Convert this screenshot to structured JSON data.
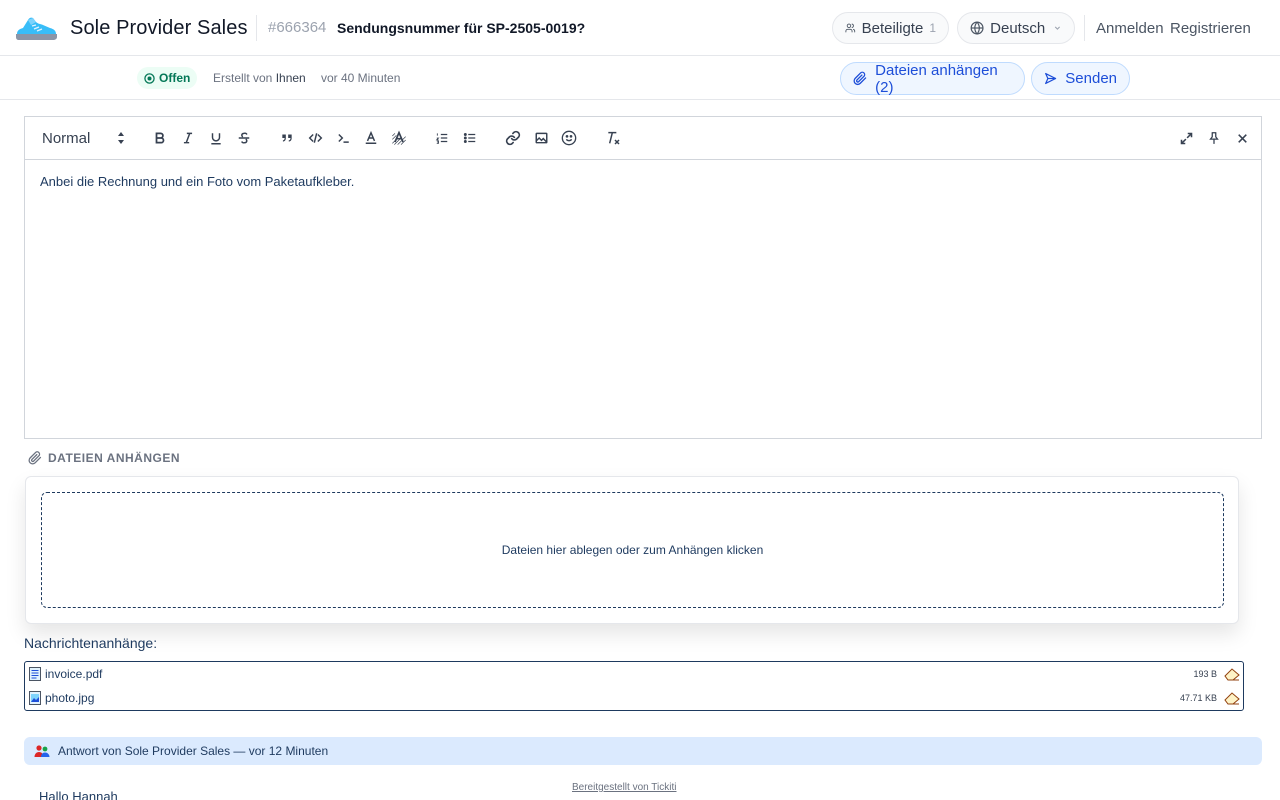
{
  "header": {
    "brand_name": "Sole Provider Sales",
    "ticket_id": "#666364",
    "ticket_title": "Sendungsnummer für SP-2505-0019?",
    "participants_label": "Beteiligte",
    "participants_count": "1",
    "language_label": "Deutsch",
    "login_label": "Anmelden",
    "register_label": "Registrieren"
  },
  "subbar": {
    "status": "Offen",
    "created_by_prefix": "Erstellt von",
    "created_by_name": "Ihnen",
    "created_ago": "vor 40 Minuten",
    "attach_button": "Dateien anhängen (2)",
    "send_button": "Senden"
  },
  "editor": {
    "format_select": "Normal",
    "body": "Anbei die Rechnung und ein Foto vom Paketaufkleber."
  },
  "attach": {
    "heading": "DATEIEN ANHÄNGEN",
    "dropzone_text": "Dateien hier ablegen oder zum Anhängen klicken"
  },
  "attachments": {
    "label": "Nachrichtenanhänge:",
    "files": [
      {
        "name": "invoice.pdf",
        "size": "193 B"
      },
      {
        "name": "photo.jpg",
        "size": "47.71 KB"
      }
    ]
  },
  "reply": {
    "header": "Antwort von Sole Provider Sales — vor 12 Minuten",
    "greeting": "Hallo Hannah",
    "powered_by": "Bereitgestellt von Tickiti"
  },
  "colors": {
    "accent": "#1d4ed8",
    "status_green": "#047857",
    "text_navy": "#1e3a5f"
  }
}
